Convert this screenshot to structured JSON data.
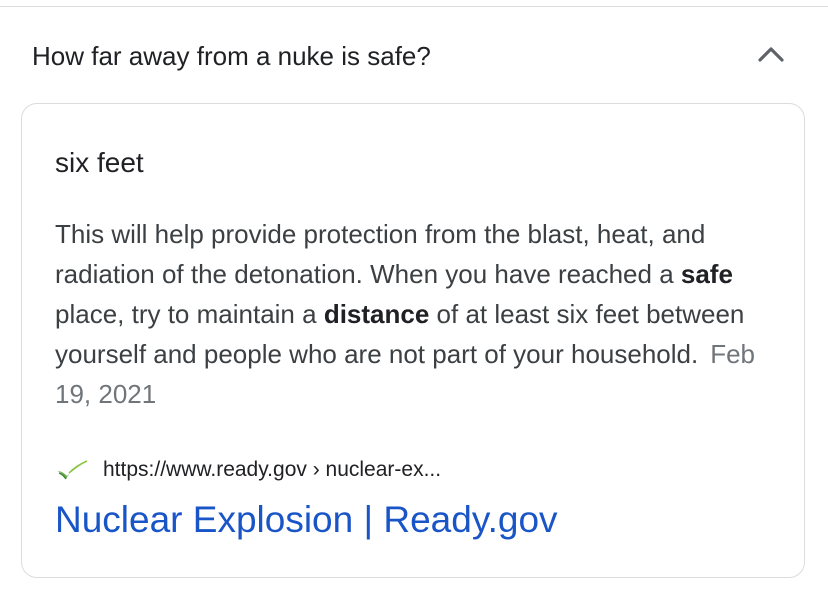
{
  "question": {
    "text": "How far away from a nuke is safe?",
    "expanded": true,
    "toggle_icon": "chevron-up-icon"
  },
  "answer": {
    "title": "six feet",
    "snippet": {
      "part1": "This will help provide protection from the blast, heat, and radiation of the detonation. When you have reached a ",
      "bold1": "safe",
      "part2": " place, try to maintain a ",
      "bold2": "distance",
      "part3": " of at least six feet between yourself and people who are not part of your household.",
      "date": "Feb 19, 2021"
    }
  },
  "source": {
    "favicon": "ready-gov-checkmark-icon",
    "url": "https://www.ready.gov › nuclear-ex...",
    "link_title": "Nuclear Explosion | Ready.gov"
  },
  "colors": {
    "link": "#1a55c8",
    "border": "#dadce0",
    "text": "#202124",
    "muted": "#70757a",
    "favicon_green": "#5aa844"
  }
}
